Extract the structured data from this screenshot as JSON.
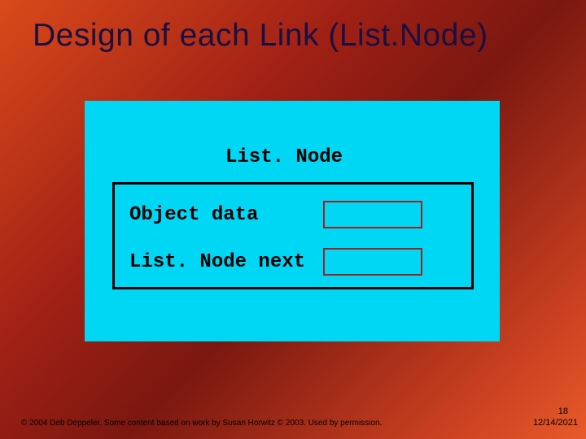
{
  "slide": {
    "title": "Design of each Link (List.Node)",
    "class_label": "List. Node",
    "fields": {
      "data": "Object data",
      "next": "List. Node next"
    },
    "footer": "© 2004 Deb Deppeler.  Some content based on work by Susan Horwitz © 2003.  Used by permission.",
    "page_number": "18",
    "date": "12/14/2021"
  }
}
